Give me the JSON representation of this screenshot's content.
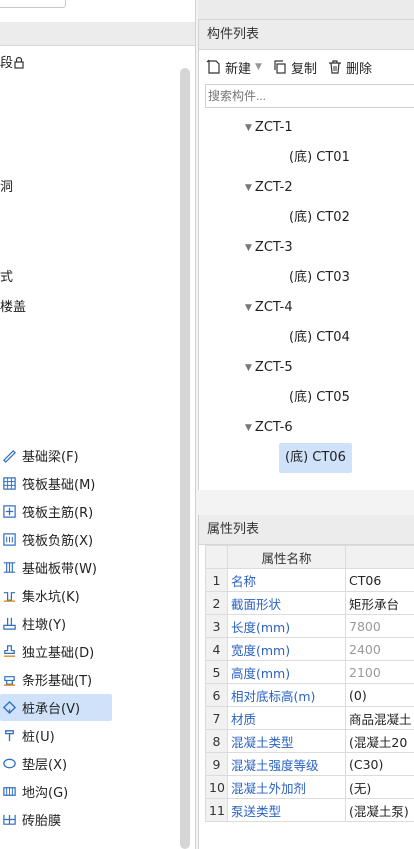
{
  "left_fragments": [
    "段",
    "洞",
    "式",
    "楼盖"
  ],
  "left_nav": [
    {
      "label": "基础梁(F)",
      "icon": "beam-icon"
    },
    {
      "label": "筏板基础(M)",
      "icon": "raft-icon"
    },
    {
      "label": "筏板主筋(R)",
      "icon": "main-rebar-icon"
    },
    {
      "label": "筏板负筋(X)",
      "icon": "neg-rebar-icon"
    },
    {
      "label": "基础板带(W)",
      "icon": "strip-icon"
    },
    {
      "label": "集水坑(K)",
      "icon": "sump-icon"
    },
    {
      "label": "柱墩(Y)",
      "icon": "pier-icon"
    },
    {
      "label": "独立基础(D)",
      "icon": "isolated-footing-icon"
    },
    {
      "label": "条形基础(T)",
      "icon": "strip-footing-icon"
    },
    {
      "label": "桩承台(V)",
      "icon": "pile-cap-icon",
      "selected": true
    },
    {
      "label": "桩(U)",
      "icon": "pile-icon"
    },
    {
      "label": "垫层(X)",
      "icon": "cushion-icon"
    },
    {
      "label": "地沟(G)",
      "icon": "trench-icon"
    },
    {
      "label": "砖胎膜",
      "icon": "brick-mold-icon"
    }
  ],
  "component_panel": {
    "title": "构件列表",
    "toolbar": {
      "new_label": "新建",
      "copy_label": "复制",
      "delete_label": "删除"
    },
    "search_placeholder": "搜索构件...",
    "tree": [
      {
        "name": "ZCT-1",
        "child": "(底) CT01"
      },
      {
        "name": "ZCT-2",
        "child": "(底) CT02"
      },
      {
        "name": "ZCT-3",
        "child": "(底) CT03"
      },
      {
        "name": "ZCT-4",
        "child": "(底) CT04"
      },
      {
        "name": "ZCT-5",
        "child": "(底) CT05"
      },
      {
        "name": "ZCT-6",
        "child": "(底) CT06",
        "selected": true
      }
    ]
  },
  "attribute_panel": {
    "title": "属性列表",
    "header_name": "属性名称",
    "rows": [
      {
        "no": "1",
        "name": "名称",
        "value": "CT06"
      },
      {
        "no": "2",
        "name": "截面形状",
        "value": "矩形承台"
      },
      {
        "no": "3",
        "name": "长度(mm)",
        "value": "7800",
        "grey": true
      },
      {
        "no": "4",
        "name": "宽度(mm)",
        "value": "2400",
        "grey": true
      },
      {
        "no": "5",
        "name": "高度(mm)",
        "value": "2100",
        "grey": true
      },
      {
        "no": "6",
        "name": "相对底标高(m)",
        "value": "(0)"
      },
      {
        "no": "7",
        "name": "材质",
        "value": "商品混凝土"
      },
      {
        "no": "8",
        "name": "混凝土类型",
        "value": "(混凝土20"
      },
      {
        "no": "9",
        "name": "混凝土强度等级",
        "value": "(C30)"
      },
      {
        "no": "10",
        "name": "混凝土外加剂",
        "value": "(无)"
      },
      {
        "no": "11",
        "name": "泵送类型",
        "value": "(混凝土泵)"
      }
    ]
  }
}
